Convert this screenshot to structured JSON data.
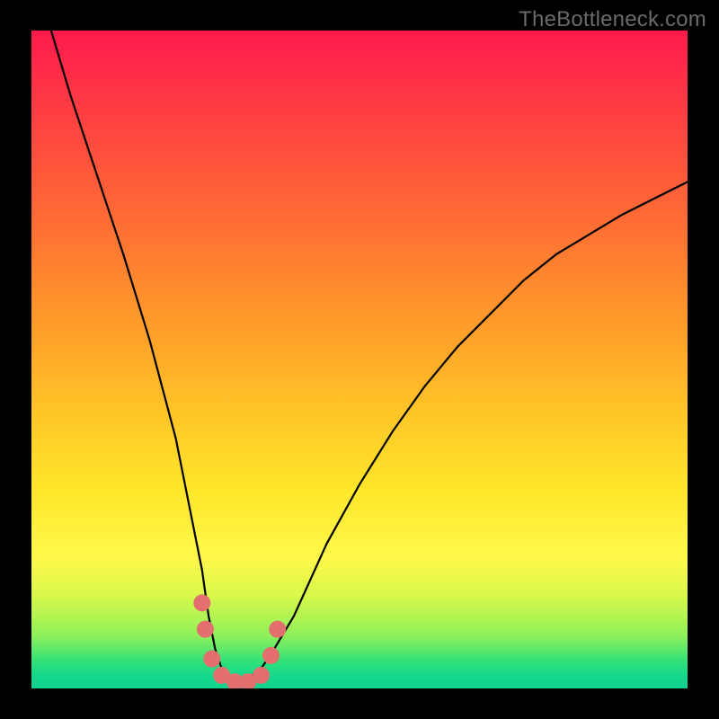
{
  "watermark": "TheBottleneck.com",
  "chart_data": {
    "type": "line",
    "title": "",
    "xlabel": "",
    "ylabel": "",
    "xlim": [
      0,
      100
    ],
    "ylim": [
      0,
      100
    ],
    "series": [
      {
        "name": "curve",
        "x": [
          3,
          6,
          10,
          14,
          18,
          22,
          24,
          26,
          27,
          28,
          29,
          30,
          31,
          32,
          33,
          35,
          37,
          40,
          45,
          50,
          55,
          60,
          65,
          70,
          75,
          80,
          85,
          90,
          95,
          100
        ],
        "y": [
          100,
          90,
          78,
          66,
          53,
          38,
          28,
          18,
          11,
          6,
          3,
          1.5,
          1,
          1,
          1.5,
          3,
          6,
          11,
          22,
          31,
          39,
          46,
          52,
          57,
          62,
          66,
          69,
          72,
          74.5,
          77
        ]
      }
    ],
    "markers": {
      "name": "bottom-dots",
      "color": "#e36f6f",
      "points": [
        {
          "x": 26.0,
          "y": 13.0
        },
        {
          "x": 26.5,
          "y": 9.0
        },
        {
          "x": 27.5,
          "y": 4.5
        },
        {
          "x": 29.0,
          "y": 2.0
        },
        {
          "x": 31.0,
          "y": 1.0
        },
        {
          "x": 33.0,
          "y": 1.0
        },
        {
          "x": 35.0,
          "y": 2.0
        },
        {
          "x": 36.5,
          "y": 5.0
        },
        {
          "x": 37.5,
          "y": 9.0
        }
      ],
      "radius_pct": 1.3
    },
    "background_gradient": {
      "top": "#ff1a4d",
      "mid": "#ffe72a",
      "bottom": "#0fd28f"
    }
  }
}
